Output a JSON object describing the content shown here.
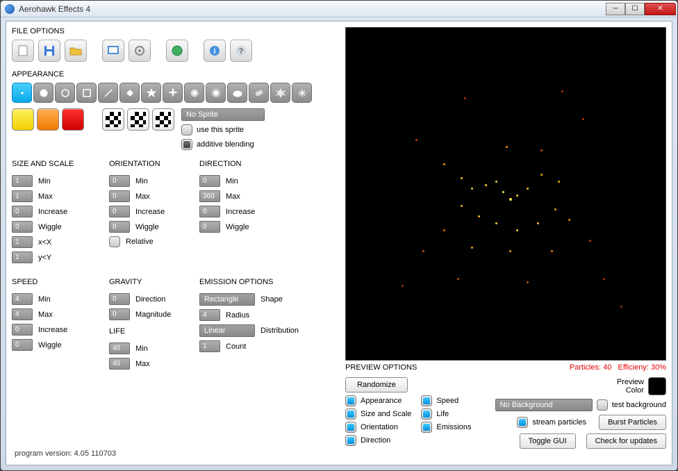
{
  "window": {
    "title": "Aerohawk Effects 4"
  },
  "sections": {
    "file": "FILE OPTIONS",
    "appearance": "APPEARANCE",
    "size": "SIZE AND SCALE",
    "orientation": "ORIENTATION",
    "direction": "DIRECTION",
    "speed": "SPEED",
    "gravity": "GRAVITY",
    "life": "LIFE",
    "emission": "EMISSION OPTIONS",
    "preview": "PREVIEW OPTIONS"
  },
  "sprite": {
    "field": "No Sprite",
    "use_label": "use this sprite",
    "additive_label": "additive blending"
  },
  "labels": {
    "min": "Min",
    "max": "Max",
    "increase": "Increase",
    "wiggle": "Wiggle",
    "xx": "x<X",
    "yy": "y<Y",
    "relative": "Relative",
    "dir": "Direction",
    "mag": "Magnitude",
    "shape": "Shape",
    "radius": "Radius",
    "distribution": "Distribution",
    "count": "Count"
  },
  "size": {
    "min": "1",
    "max": "1",
    "increase": "0",
    "wiggle": "0",
    "xx": "1",
    "yy": "1"
  },
  "orientation": {
    "min": "0",
    "max": "0",
    "increase": "0",
    "wiggle": "0"
  },
  "direction": {
    "min": "0",
    "max": "360",
    "increase": "0",
    "wiggle": "0"
  },
  "speed": {
    "min": "4",
    "max": "4",
    "increase": "0",
    "wiggle": "0"
  },
  "gravity": {
    "direction": "0",
    "magnitude": "0"
  },
  "life": {
    "min": "40",
    "max": "40"
  },
  "emission": {
    "shape": "Rectangle",
    "radius": "4",
    "distribution": "Linear",
    "count": "1"
  },
  "colors": {
    "c1": "#ffe000",
    "c2": "#ff8c1a",
    "c3": "#e81010"
  },
  "preview_status": {
    "particles_label": "Particles: 40",
    "efficiency_label": "Efficieny: 30%"
  },
  "preview": {
    "randomize": "Randomize",
    "appearance": "Appearance",
    "size": "Size and Scale",
    "orientation": "Orientation",
    "direction": "Direction",
    "speed": "Speed",
    "life": "Life",
    "emissions": "Emissions",
    "preview_color": "Preview\nColor",
    "no_bg": "No Background",
    "test_bg": "test background",
    "stream": "stream particles",
    "burst": "Burst Particles",
    "toggle": "Toggle GUI",
    "updates": "Check for updates"
  },
  "statusbar": "program version: 4.05 110703"
}
